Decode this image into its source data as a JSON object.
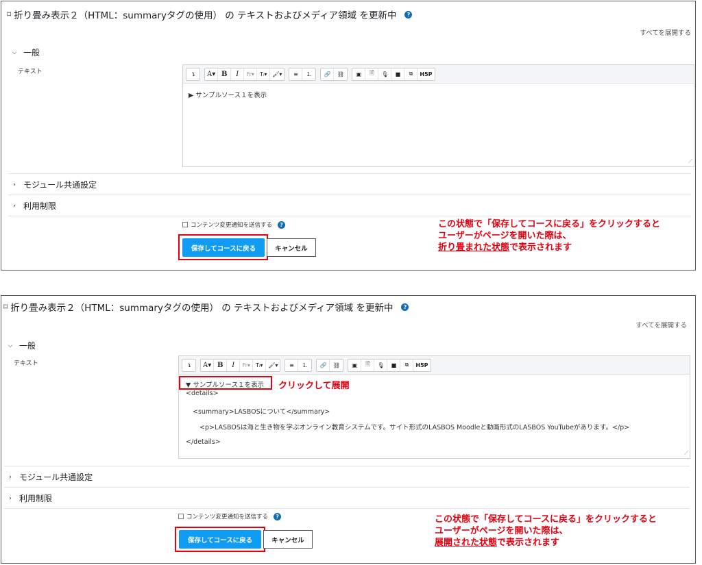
{
  "panel1": {
    "title": "折り畳み表示２（HTML：summaryタグの使用） の テキストおよびメディア領域 を更新中",
    "expand_all": "すべてを展開する",
    "section_general": "一般",
    "field_label": "テキスト",
    "toolbar": {
      "groups": [
        [
          "↴"
        ],
        [
          "A▾",
          "B",
          "I",
          "Fr▾",
          "Tᵢ▾",
          "🖌▾"
        ],
        [
          "≡",
          "⒈"
        ],
        [
          "🔗",
          "⛓"
        ],
        [
          "▣",
          "🖹",
          "🎙",
          "■",
          "⧉",
          "H5P"
        ]
      ]
    },
    "content_line": "▶ サンプルソース１を表示",
    "section_common": "モジュール共通設定",
    "section_restrict": "利用制限",
    "notify_label": "コンテンツ変更通知を送信する",
    "save_button": "保存してコースに戻る",
    "cancel_button": "キャンセル",
    "note_line1": "この状態で「保存してコースに戻る」をクリックすると",
    "note_line2": "ユーザーがページを開いた際は、",
    "note_line3_underlined": "折り畳まれた状態",
    "note_line3_rest": "で表示されます"
  },
  "panel2": {
    "title": "折り畳み表示２（HTML：summaryタグの使用） の テキストおよびメディア領域 を更新中",
    "expand_all": "すべてを展開する",
    "section_general": "一般",
    "field_label": "テキスト",
    "summary_line": "▼ サンプルソース１を表示",
    "click_note": "クリックして展開",
    "code_lines": [
      "<details>",
      "<summary>LASBOSについて</summary>",
      "<p>LASBOSは海と生き物を学ぶオンライン教育システムです。サイト形式のLASBOS Moodleと動画形式のLASBOS YouTubeがあります。</p>",
      "</details>"
    ],
    "section_common": "モジュール共通設定",
    "section_restrict": "利用制限",
    "notify_label": "コンテンツ変更通知を送信する",
    "save_button": "保存してコースに戻る",
    "cancel_button": "キャンセル",
    "note_line1": "この状態で「保存してコースに戻る」をクリックすると",
    "note_line2": "ユーザーがページを開いた際は、",
    "note_line3_underlined": "展開された状態",
    "note_line3_rest": "で表示されます"
  },
  "colors": {
    "primary_button": "#0f9cf2",
    "annotation_red": "#e3000f",
    "help_icon": "#0f6cbf"
  }
}
